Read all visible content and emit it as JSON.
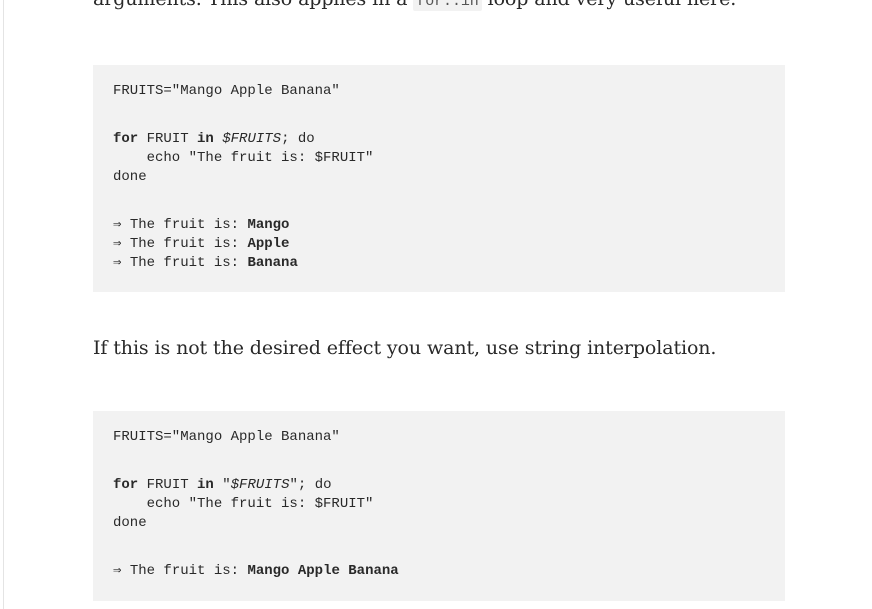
{
  "intro_paragraph": {
    "before": "arguments. This also applies in a ",
    "code": "for..in",
    "after": " loop and very useful here."
  },
  "code_block_1": {
    "assign": "FRUITS=\"Mango Apple Banana\"",
    "loop_for": "for",
    "loop_var": " FRUIT ",
    "loop_in": "in",
    "loop_space": " ",
    "loop_list": "$FRUITS",
    "loop_semi": "; ",
    "loop_do": "do",
    "echo": "    echo \"The fruit is: $FRUIT\"",
    "done": "done",
    "outputs": [
      {
        "prefix": "⇒ The fruit is: ",
        "value": "Mango"
      },
      {
        "prefix": "⇒ The fruit is: ",
        "value": "Apple"
      },
      {
        "prefix": "⇒ The fruit is: ",
        "value": "Banana"
      }
    ]
  },
  "middle_paragraph": "If this is not the desired effect you want, use string interpolation.",
  "code_block_2": {
    "assign": "FRUITS=\"Mango Apple Banana\"",
    "loop_for": "for",
    "loop_var": " FRUIT ",
    "loop_in": "in",
    "loop_open_quote": " \"",
    "loop_list": "$FRUITS",
    "loop_close": "\"; ",
    "loop_do": "do",
    "echo": "    echo \"The fruit is: $FRUIT\"",
    "done": "done",
    "output_prefix": "⇒ The fruit is: ",
    "output_value": "Mango Apple Banana"
  }
}
